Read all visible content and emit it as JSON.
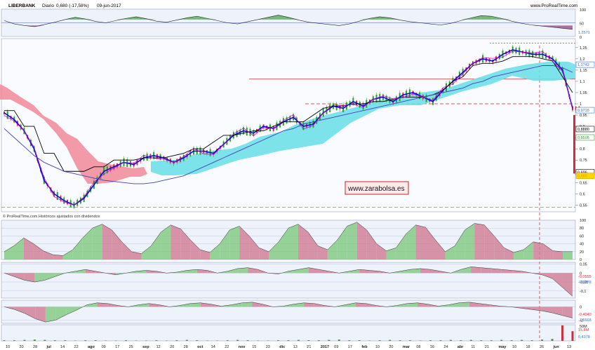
{
  "header": {
    "ticker": "LIBERBANK",
    "period": "Diario",
    "price": "0,680 (-17,58%)",
    "date": "09-jun-2017",
    "source": "www.ProRealTime.com"
  },
  "footer_note": "© ProRealTime.com  Históricos ajustados con dividendos",
  "watermark": "www.zarabolsa.es",
  "colors": {
    "up": "#2e9e2e",
    "down": "#c8323c",
    "ma": "#0b0bd8",
    "kijun": "#000000",
    "tenkan": "#cc00cc",
    "slow_ma": "#4040b8",
    "cloud_bull": "#6fe0e8",
    "cloud_bear": "#f08898",
    "panel_bg": "#eef2fb"
  },
  "chart_data": [
    {
      "type": "line",
      "panel": "oscillator-top",
      "ylim": [
        0,
        100
      ],
      "y_ticks": [
        "100",
        "50",
        "0"
      ],
      "last_value_label": "1,2571",
      "series": [
        {
          "values": [
            58,
            46,
            40,
            36,
            44,
            52,
            62,
            70,
            64,
            55,
            50,
            58,
            66,
            72,
            65,
            56,
            52,
            60,
            68,
            74,
            66,
            58,
            50,
            46,
            54,
            62,
            70,
            78,
            70,
            60,
            52,
            48,
            44,
            40,
            46,
            56,
            66,
            72,
            68,
            60,
            54,
            50,
            46,
            42,
            48,
            58,
            68,
            76,
            74,
            66,
            56,
            48,
            42,
            38,
            34,
            30,
            26
          ]
        }
      ]
    },
    {
      "type": "line",
      "panel": "price",
      "ylim": [
        0.52,
        1.29
      ],
      "y_ticks": [
        "1,25",
        "1,2",
        "1,15",
        "1,1",
        "1,05",
        "1",
        "0,95",
        "0,9",
        "0,85",
        "0,8",
        "0,75",
        "0,7",
        "0,65",
        "0,6",
        "0,55"
      ],
      "value_labels": [
        "1,1742",
        "0,9718",
        "0,8880",
        "0,8505",
        "0,696",
        "0,680"
      ],
      "x_ticks": [
        "10",
        "20",
        "28",
        "jul",
        "14",
        "22",
        "ago",
        "09",
        "17",
        "25",
        "sep",
        "12",
        "20",
        "28",
        "oct",
        "14",
        "22",
        "nov",
        "15",
        "23",
        "dic",
        "13",
        "21",
        "2017",
        "09",
        "17",
        "feb",
        "10",
        "20",
        "mar",
        "08",
        "16",
        "24",
        "abr",
        "11",
        "21",
        "may",
        "10",
        "18",
        "26",
        "jun",
        "13"
      ],
      "series": [
        {
          "values": [
            0.96,
            0.93,
            0.88,
            0.8,
            0.66,
            0.6,
            0.57,
            0.55,
            0.58,
            0.64,
            0.7,
            0.72,
            0.74,
            0.73,
            0.76,
            0.77,
            0.76,
            0.74,
            0.76,
            0.79,
            0.79,
            0.78,
            0.82,
            0.86,
            0.88,
            0.87,
            0.9,
            0.89,
            0.92,
            0.94,
            0.9,
            0.91,
            0.96,
            0.99,
            0.98,
            1.01,
            0.99,
            1.02,
            1.03,
            1.01,
            1.04,
            1.05,
            1.03,
            1.01,
            1.06,
            1.1,
            1.14,
            1.18,
            1.2,
            1.19,
            1.22,
            1.24,
            1.23,
            1.22,
            1.22,
            1.2,
            1.15,
            0.98
          ]
        },
        {
          "values": [
            0.97,
            0.97,
            0.9,
            0.9,
            0.78,
            0.78,
            0.7,
            0.7,
            0.7,
            0.72,
            0.72,
            0.75,
            0.75,
            0.75,
            0.76,
            0.76,
            0.76,
            0.77,
            0.78,
            0.8,
            0.8,
            0.83,
            0.86,
            0.86,
            0.87,
            0.88,
            0.88,
            0.9,
            0.92,
            0.92,
            0.92,
            0.95,
            0.98,
            0.99,
            0.99,
            1.0,
            1.0,
            1.01,
            1.01,
            1.02,
            1.03,
            1.03,
            1.03,
            1.04,
            1.06,
            1.1,
            1.12,
            1.17,
            1.18,
            1.18,
            1.19,
            1.21,
            1.21,
            1.21,
            1.2,
            1.19,
            1.12,
            1.05
          ]
        },
        {
          "values": [
            0.89,
            0.85,
            0.81,
            0.77,
            0.74,
            0.72,
            0.7,
            0.69,
            0.68,
            0.67,
            0.66,
            0.655,
            0.65,
            0.645,
            0.645,
            0.65,
            0.66,
            0.67,
            0.68,
            0.7,
            0.72,
            0.74,
            0.76,
            0.78,
            0.8,
            0.82,
            0.84,
            0.86,
            0.88,
            0.89,
            0.91,
            0.92,
            0.93,
            0.94,
            0.95,
            0.96,
            0.97,
            0.98,
            0.99,
            1.0,
            1.01,
            1.02,
            1.03,
            1.04,
            1.05,
            1.06,
            1.07,
            1.09,
            1.1,
            1.12,
            1.13,
            1.14,
            1.15,
            1.16,
            1.17,
            1.17,
            1.16,
            1.14
          ]
        }
      ]
    },
    {
      "type": "area",
      "panel": "stochastic",
      "ylim": [
        0,
        100
      ],
      "y_ticks": [
        "100",
        "80",
        "60",
        "40",
        "20",
        "0"
      ],
      "series": [
        {
          "values": [
            20,
            35,
            55,
            40,
            22,
            12,
            10,
            25,
            55,
            80,
            90,
            75,
            45,
            20,
            15,
            35,
            70,
            88,
            78,
            50,
            25,
            18,
            40,
            75,
            85,
            60,
            30,
            20,
            45,
            80,
            90,
            70,
            35,
            25,
            50,
            85,
            95,
            75,
            40,
            22,
            30,
            65,
            88,
            82,
            50,
            20,
            35,
            75,
            92,
            88,
            60,
            30,
            18,
            25,
            45,
            40,
            22,
            20,
            20
          ]
        }
      ]
    },
    {
      "type": "area",
      "panel": "macd",
      "ylim": [
        -0.14,
        0.06
      ],
      "y_ticks": [
        "0,05",
        "0",
        "-0,05",
        "-0,1"
      ],
      "value_labels": [
        "-0,0555",
        "-0,1378"
      ],
      "series": [
        {
          "values": [
            0.0,
            -0.02,
            -0.04,
            -0.05,
            -0.04,
            -0.02,
            0.0,
            0.01,
            0.02,
            0.01,
            0.0,
            -0.01,
            0.0,
            0.01,
            0.015,
            0.01,
            0.0,
            0.005,
            0.015,
            0.02,
            0.015,
            0.0,
            0.01,
            0.025,
            0.03,
            0.02,
            0.0,
            -0.005,
            0.01,
            0.02,
            0.03,
            0.02,
            0.01,
            0.0,
            0.01,
            0.02,
            0.015,
            0.01,
            0.0,
            0.01,
            0.02,
            0.025,
            0.02,
            0.01,
            0.0,
            0.02,
            0.035,
            0.03,
            0.025,
            0.02,
            0.015,
            0.01,
            0.0,
            -0.01,
            -0.03,
            -0.08,
            -0.13
          ]
        }
      ]
    },
    {
      "type": "area",
      "panel": "momentum",
      "ylim": [
        -2.5,
        1
      ],
      "y_ticks": [
        "0",
        "-2"
      ],
      "value_labels": [
        "-0,4040",
        "-1,6668"
      ],
      "series": [
        {
          "values": [
            0.0,
            -0.4,
            -1.0,
            -1.8,
            -2.3,
            -2.0,
            -1.2,
            -0.5,
            0.3,
            0.6,
            0.5,
            0.2,
            0.0,
            0.3,
            0.5,
            0.3,
            0.0,
            0.2,
            0.5,
            0.6,
            0.4,
            0.1,
            0.3,
            0.6,
            0.7,
            0.4,
            0.0,
            0.1,
            0.4,
            0.6,
            0.5,
            0.2,
            0.0,
            0.3,
            0.6,
            0.5,
            0.2,
            0.0,
            0.2,
            0.5,
            0.6,
            0.4,
            0.1,
            0.3,
            0.6,
            0.7,
            0.5,
            0.3,
            0.1,
            0.0,
            -0.2,
            -0.4,
            -0.6,
            -0.9,
            -1.3,
            -1.7
          ]
        }
      ]
    },
    {
      "type": "bar",
      "panel": "volume",
      "ylim": [
        0,
        50
      ],
      "y_ticks": [
        "50M"
      ],
      "value_labels": [
        "15,8M",
        "0,4378"
      ],
      "series": [
        {
          "values": [
            2,
            2,
            3,
            4,
            3,
            2,
            2,
            1,
            2,
            2,
            1,
            1,
            2,
            1,
            1,
            2,
            1,
            2,
            3,
            2,
            1,
            1,
            2,
            3,
            2,
            1,
            1,
            2,
            2,
            3,
            2,
            2,
            3,
            4,
            2,
            2,
            1,
            2,
            3,
            2,
            2,
            1,
            2,
            2,
            3,
            2,
            3,
            2,
            2,
            3,
            2,
            3,
            2,
            4,
            6,
            48,
            30
          ]
        }
      ]
    }
  ]
}
